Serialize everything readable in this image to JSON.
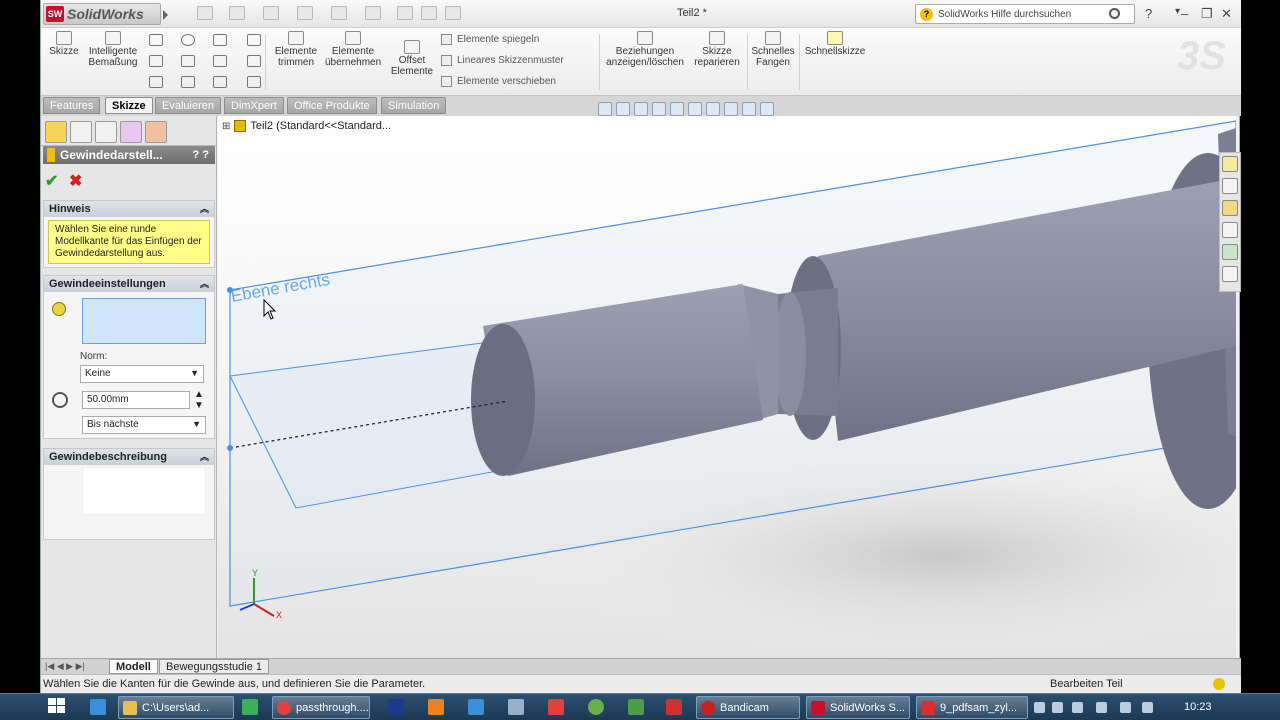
{
  "app": {
    "logo_text": "SolidWorks",
    "document_title": "Teil2 *",
    "help_search_placeholder": "SolidWorks Hilfe durchsuchen"
  },
  "ribbon": {
    "skizze": "Skizze",
    "smart_dim": "Intelligente Bemaßung",
    "trim": "Elemente trimmen",
    "convert": "Elemente übernehmen",
    "offset": "Offset Elemente",
    "mirror": "Elemente spiegeln",
    "linear_pattern": "Lineares Skizzenmuster",
    "move": "Elemente verschieben",
    "relations": "Beziehungen anzeigen/löschen",
    "repair": "Skizze reparieren",
    "quick_snaps": "Schnelles Fangen",
    "rapid_sketch": "Schnellskizze"
  },
  "tabs": [
    "Features",
    "Skizze",
    "Evaluieren",
    "DimXpert",
    "Office Produkte",
    "Simulation"
  ],
  "active_tab": "Skizze",
  "property_manager": {
    "title": "Gewindedarstell...",
    "hint_section": "Hinweis",
    "hint_text": "Wählen Sie eine runde Modellkante für das Einfügen der Gewindedarstellung aus.",
    "settings_section": "Gewindeeinstellungen",
    "norm_label": "Norm:",
    "norm_value": "Keine",
    "diameter_value": "50.00mm",
    "end_condition": "Bis nächste",
    "description_section": "Gewindebeschreibung"
  },
  "viewport": {
    "tree_label": "Teil2  (Standard<<Standard...",
    "plane_label": "Ebene rechts",
    "axis_y": "Y",
    "axis_x": "X"
  },
  "bottom_tabs": [
    "Modell",
    "Bewegungsstudie 1"
  ],
  "status": {
    "message": "Wählen Sie die Kanten für die Gewinde aus, und definieren Sie die Parameter.",
    "mode": "Bearbeiten Teil"
  },
  "taskbar": {
    "items": [
      "C:\\Users\\ad...",
      "passthrough....",
      "Bandicam",
      "SolidWorks S...",
      "9_pdfsam_zyl..."
    ],
    "clock": "10:23"
  },
  "colors": {
    "shaft": "#8a8d9f",
    "plane_edge": "#4a90e2",
    "hint_bg": "#ffff88",
    "selection_box": "#cfe6fa"
  }
}
